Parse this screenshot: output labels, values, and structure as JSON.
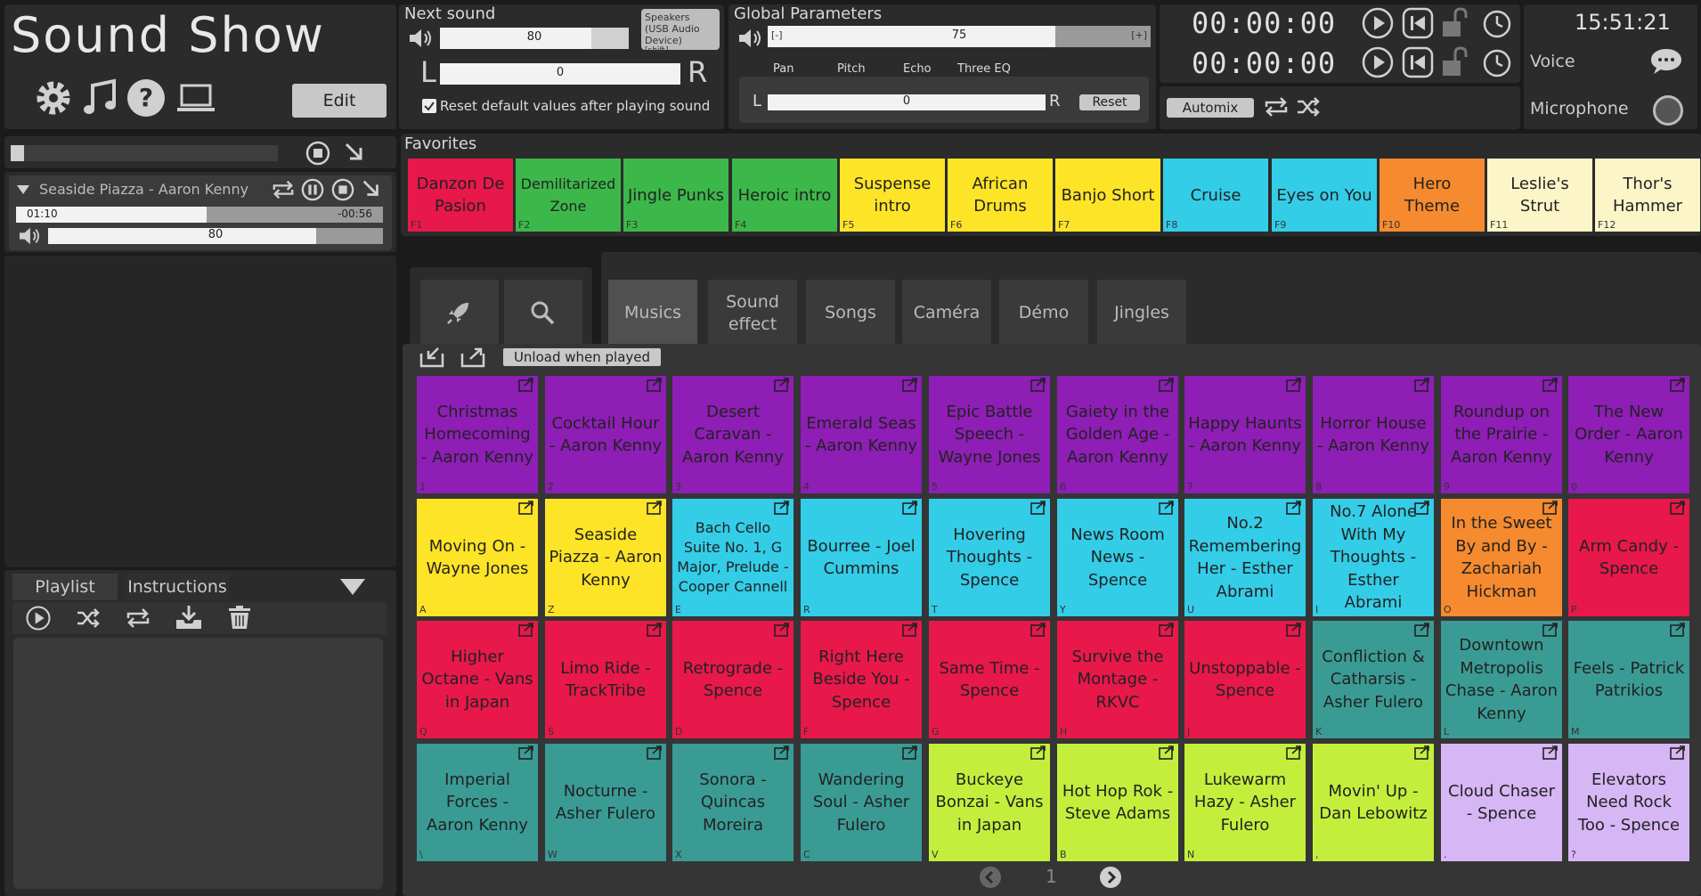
{
  "app": {
    "title": "Sound Show",
    "edit_label": "Edit"
  },
  "next_sound": {
    "title": "Next sound",
    "volume": 80,
    "volume_fraction": 0.8,
    "pan": 0,
    "left_label": "L",
    "right_label": "R",
    "speaker_label": "Speakers (USB Audio Device)",
    "speaker_hint": "[shift]",
    "reset_label": "Reset default values after playing sound",
    "reset_checked": true
  },
  "global": {
    "title": "Global Parameters",
    "volume": 75,
    "volume_fraction": 0.75,
    "minus_label": "[-]",
    "plus_label": "[+]",
    "eq_tabs": [
      "Pan",
      "Pitch",
      "Echo",
      "Three EQ"
    ],
    "pan": 0,
    "left_label": "L",
    "right_label": "R",
    "reset_label": "Reset"
  },
  "timers": {
    "time1": "00:00:00",
    "time2": "00:00:00",
    "automix_label": "Automix"
  },
  "clock": {
    "time": "15:51:21",
    "voice_label": "Voice",
    "microphone_label": "Microphone"
  },
  "player": {
    "title": "Seaside Piazza - Aaron Kenny",
    "elapsed": "01:10",
    "remaining": "-00:56",
    "progress_fraction": 0.52,
    "volume": 80,
    "volume_fraction": 0.8
  },
  "playlist": {
    "tabs": [
      "Playlist",
      "Instructions"
    ]
  },
  "favorites": {
    "title": "Favorites",
    "items": [
      {
        "label": "Danzon De Pasion",
        "key": "F1",
        "color": "#e8184a"
      },
      {
        "label": "Demilitarized Zone",
        "key": "F2",
        "color": "#3cb84a"
      },
      {
        "label": "Jingle Punks",
        "key": "F3",
        "color": "#3cb84a"
      },
      {
        "label": "Heroic intro",
        "key": "F4",
        "color": "#3cb84a"
      },
      {
        "label": "Suspense intro",
        "key": "F5",
        "color": "#fde427"
      },
      {
        "label": "African Drums",
        "key": "F6",
        "color": "#fde427"
      },
      {
        "label": "Banjo Short",
        "key": "F7",
        "color": "#fde427"
      },
      {
        "label": "Cruise",
        "key": "F8",
        "color": "#33cde8"
      },
      {
        "label": "Eyes on You",
        "key": "F9",
        "color": "#33cde8"
      },
      {
        "label": "Hero Theme",
        "key": "F10",
        "color": "#f58a2e"
      },
      {
        "label": "Leslie's Strut",
        "key": "F11",
        "color": "#fcf5c8"
      },
      {
        "label": "Thor's Hammer",
        "key": "F12",
        "color": "#fcf5c8"
      }
    ]
  },
  "categories": {
    "tabs": [
      "Musics",
      "Sound effect",
      "Songs",
      "Caméra",
      "Démo",
      "Jingles"
    ]
  },
  "grid": {
    "unload_label": "Unload when played",
    "page": "1",
    "rows": [
      [
        {
          "label": "Christmas Homecoming - Aaron Kenny",
          "key": "1",
          "color": "#8e1eb5"
        },
        {
          "label": "Cocktail Hour - Aaron Kenny",
          "key": "2",
          "color": "#8e1eb5"
        },
        {
          "label": "Desert Caravan - Aaron Kenny",
          "key": "3",
          "color": "#8e1eb5"
        },
        {
          "label": "Emerald Seas - Aaron Kenny",
          "key": "4",
          "color": "#8e1eb5"
        },
        {
          "label": "Epic Battle Speech - Wayne Jones",
          "key": "5",
          "color": "#8e1eb5"
        },
        {
          "label": "Gaiety in the Golden Age - Aaron Kenny",
          "key": "6",
          "color": "#8e1eb5"
        },
        {
          "label": "Happy Haunts - Aaron Kenny",
          "key": "7",
          "color": "#8e1eb5"
        },
        {
          "label": "Horror House - Aaron Kenny",
          "key": "8",
          "color": "#8e1eb5"
        },
        {
          "label": "Roundup on the Prairie - Aaron Kenny",
          "key": "9",
          "color": "#8e1eb5"
        },
        {
          "label": "The New Order - Aaron Kenny",
          "key": "0",
          "color": "#8e1eb5"
        }
      ],
      [
        {
          "label": "Moving On - Wayne Jones",
          "key": "A",
          "color": "#fde427"
        },
        {
          "label": "Seaside Piazza - Aaron Kenny",
          "key": "Z",
          "color": "#fde427"
        },
        {
          "label": "Bach Cello Suite No. 1, G Major, Prelude - Cooper Cannell",
          "key": "E",
          "color": "#33cde8",
          "small": true
        },
        {
          "label": "Bourree - Joel Cummins",
          "key": "R",
          "color": "#33cde8"
        },
        {
          "label": "Hovering Thoughts - Spence",
          "key": "T",
          "color": "#33cde8"
        },
        {
          "label": "News Room News - Spence",
          "key": "Y",
          "color": "#33cde8"
        },
        {
          "label": "No.2 Remembering Her - Esther Abrami",
          "key": "U",
          "color": "#33cde8"
        },
        {
          "label": "No.7 Alone With My Thoughts - Esther Abrami",
          "key": "I",
          "color": "#33cde8"
        },
        {
          "label": "In the Sweet By and By - Zachariah Hickman",
          "key": "O",
          "color": "#f58a2e"
        },
        {
          "label": "Arm Candy - Spence",
          "key": "P",
          "color": "#e8184a"
        }
      ],
      [
        {
          "label": "Higher Octane - Vans in Japan",
          "key": "Q",
          "color": "#e8184a"
        },
        {
          "label": "Limo Ride - TrackTribe",
          "key": "S",
          "color": "#e8184a"
        },
        {
          "label": "Retrograde - Spence",
          "key": "D",
          "color": "#e8184a"
        },
        {
          "label": "Right Here Beside You - Spence",
          "key": "F",
          "color": "#e8184a"
        },
        {
          "label": "Same Time - Spence",
          "key": "G",
          "color": "#e8184a"
        },
        {
          "label": "Survive the Montage - RKVC",
          "key": "H",
          "color": "#e8184a"
        },
        {
          "label": "Unstoppable - Spence",
          "key": "J",
          "color": "#e8184a"
        },
        {
          "label": "Confliction & Catharsis - Asher Fulero",
          "key": "K",
          "color": "#3a9b94"
        },
        {
          "label": "Downtown Metropolis Chase - Aaron Kenny",
          "key": "L",
          "color": "#3a9b94"
        },
        {
          "label": "Feels - Patrick Patrikios",
          "key": "M",
          "color": "#3a9b94"
        }
      ],
      [
        {
          "label": "Imperial Forces - Aaron Kenny",
          "key": "\\",
          "color": "#3a9b94"
        },
        {
          "label": "Nocturne - Asher Fulero",
          "key": "W",
          "color": "#3a9b94"
        },
        {
          "label": "Sonora - Quincas Moreira",
          "key": "X",
          "color": "#3a9b94"
        },
        {
          "label": "Wandering Soul - Asher Fulero",
          "key": "C",
          "color": "#3a9b94"
        },
        {
          "label": "Buckeye Bonzai - Vans in Japan",
          "key": "V",
          "color": "#c3ef3c"
        },
        {
          "label": "Hot Hop Rok - Steve Adams",
          "key": "B",
          "color": "#c3ef3c"
        },
        {
          "label": "Lukewarm Hazy - Asher Fulero",
          "key": "N",
          "color": "#c3ef3c"
        },
        {
          "label": "Movin' Up - Dan Lebowitz",
          "key": ",",
          "color": "#c3ef3c"
        },
        {
          "label": "Cloud Chaser - Spence",
          "key": ".",
          "color": "#d6b6f5"
        },
        {
          "label": "Elevators Need Rock Too - Spence",
          "key": "?",
          "color": "#d6b6f5"
        }
      ]
    ]
  }
}
